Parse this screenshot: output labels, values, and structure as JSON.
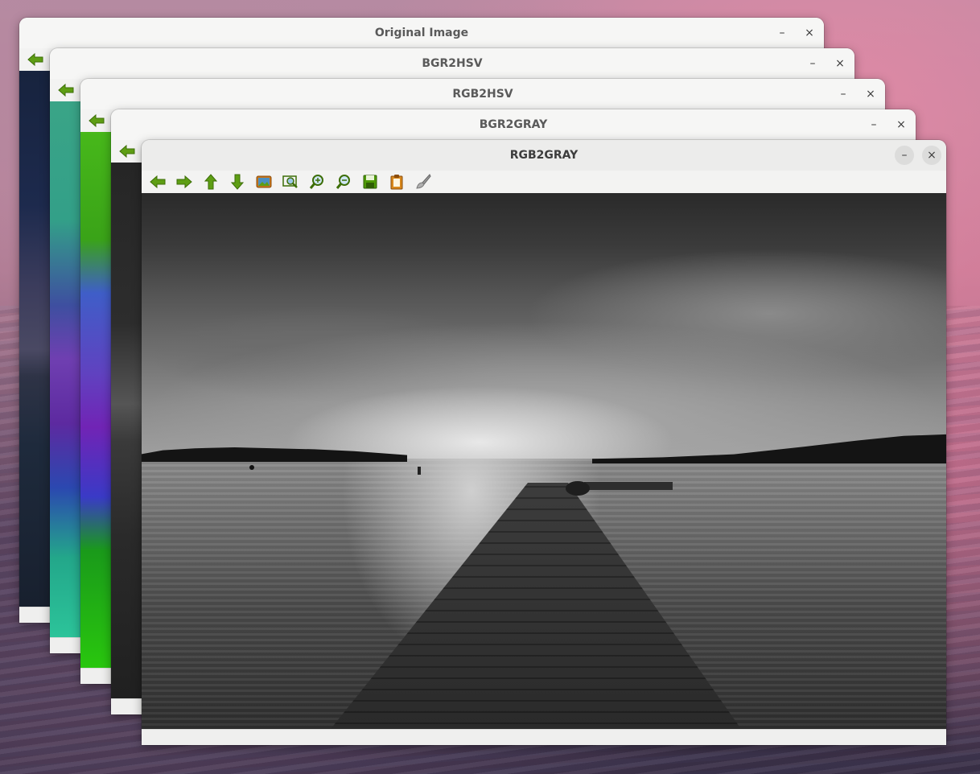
{
  "windows": {
    "original": {
      "title": "Original Image"
    },
    "bgr2hsv": {
      "title": "BGR2HSV"
    },
    "rgb2hsv": {
      "title": "RGB2HSV"
    },
    "bgr2gray": {
      "title": "BGR2GRAY"
    },
    "rgb2gray": {
      "title": "RGB2GRAY"
    }
  },
  "controls": {
    "minimize_glyph": "–",
    "close_glyph": "×"
  },
  "toolbar": {
    "tools": [
      "pan-left-icon",
      "pan-right-icon",
      "pan-up-icon",
      "pan-down-icon",
      "zoom-in-fit-icon",
      "zoom-to-area-icon",
      "zoom-in-icon",
      "zoom-out-icon",
      "save-icon",
      "copy-clipboard-icon",
      "properties-brush-icon"
    ]
  },
  "colors": {
    "icon_green": "#4e9a06",
    "icon_green_light": "#8ae234"
  }
}
